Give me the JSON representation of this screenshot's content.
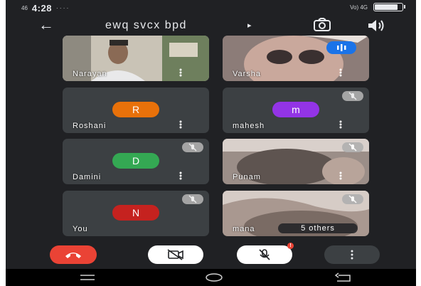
{
  "status_bar": {
    "time": "4:28",
    "network_left": "46",
    "extra": "· · · ·",
    "right_text": "Vo) 4G",
    "battery_level": 0.8
  },
  "meeting": {
    "title": "ewq svcx bpd",
    "title_chevron": "▸",
    "back_icon": "arrow-left-icon",
    "camera_icon": "camera-switch-icon",
    "audio_icon": "speaker-icon"
  },
  "participants": [
    {
      "name": "Narayan",
      "initial": "",
      "avatar_color": "",
      "has_video": true,
      "muted": false,
      "speaking": false
    },
    {
      "name": "Varsha",
      "initial": "",
      "avatar_color": "",
      "has_video": true,
      "muted": false,
      "speaking": true
    },
    {
      "name": "Roshani",
      "initial": "R",
      "avatar_color": "#e8710a",
      "has_video": false,
      "muted": false,
      "speaking": false
    },
    {
      "name": "mahesh",
      "initial": "m",
      "avatar_color": "#9334e6",
      "has_video": false,
      "muted": true,
      "speaking": false
    },
    {
      "name": "Damini",
      "initial": "D",
      "avatar_color": "#34a853",
      "has_video": false,
      "muted": true,
      "speaking": false
    },
    {
      "name": "Punam",
      "initial": "",
      "avatar_color": "",
      "has_video": true,
      "muted": true,
      "speaking": false
    },
    {
      "name": "You",
      "initial": "N",
      "avatar_color": "#c5221f",
      "has_video": false,
      "muted": true,
      "speaking": false
    },
    {
      "name": "mana",
      "initial": "",
      "avatar_color": "",
      "has_video": true,
      "muted": true,
      "speaking": false,
      "others_label": "5 others"
    }
  ],
  "controls": {
    "end_call": {
      "icon": "end-call-icon",
      "color": "#ea4335"
    },
    "camera": {
      "icon": "camera-off-icon",
      "color": "#ffffff"
    },
    "mic": {
      "icon": "mic-off-icon",
      "color": "#ffffff",
      "badge": "!"
    },
    "more": {
      "icon": "more-vert-icon",
      "color": "#3c4043"
    }
  },
  "nav_bar": {
    "recent": "recent-apps-icon",
    "home": "home-icon",
    "back": "back-nav-icon"
  },
  "colors": {
    "background": "#202124",
    "tile": "#3c4043",
    "speaking": "#1a73e8",
    "end_call": "#ea4335"
  }
}
